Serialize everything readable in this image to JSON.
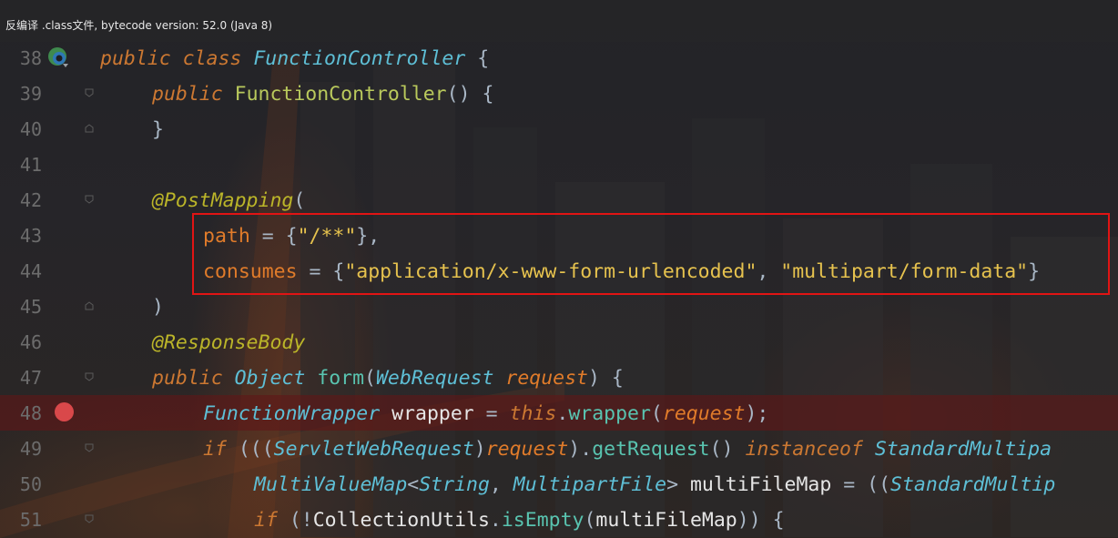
{
  "window": {
    "title": "反编译 .class文件, bytecode version: 52.0 (Java 8)"
  },
  "colors": {
    "keyword": "#cc7832",
    "string": "#e6c24e",
    "annotation": "#bbb529",
    "type": "#5ebfd6",
    "method": "#59c4b0",
    "highlight_border": "#e11414",
    "breakpoint": "#d9484a",
    "breakpoint_line": "#5f1616"
  },
  "gutter": {
    "line_numbers": [
      "38",
      "39",
      "40",
      "41",
      "42",
      "43",
      "44",
      "45",
      "46",
      "47",
      "48",
      "49",
      "50",
      "51"
    ],
    "class_icon": "class-implementation-icon",
    "breakpoint_line": "48"
  },
  "code": {
    "l38": {
      "kw1": "public",
      "kw2": "class",
      "name": "FunctionController",
      "brace": " {"
    },
    "l39": {
      "kw1": "public",
      "name": "FunctionController",
      "rest": "() {"
    },
    "l40": {
      "brace": "}"
    },
    "l42": {
      "ann": "@PostMapping",
      "paren": "("
    },
    "l43": {
      "attr": "path",
      "eq": " = {",
      "str": "\"/**\"",
      "end": "},"
    },
    "l44": {
      "attr": "consumes",
      "eq": " = {",
      "str1": "\"application/x-www-form-urlencoded\"",
      "comma": ", ",
      "str2": "\"multipart/form-data\"",
      "end": "}"
    },
    "l45": {
      "paren": ")"
    },
    "l46": {
      "ann": "@ResponseBody"
    },
    "l47": {
      "kw1": "public",
      "type": "Object",
      "method": "form",
      "open": "(",
      "ptype": "WebRequest",
      "pname": "request",
      "close": ") {"
    },
    "l48": {
      "type": "FunctionWrapper",
      "var": " wrapper",
      "eq": " = ",
      "kw": "this",
      "dot": ".",
      "method": "wrapper",
      "open": "(",
      "arg": "request",
      "close": ");"
    },
    "l49": {
      "kw": "if",
      "p1": " (((",
      "type": "ServletWebRequest",
      "p2": ")",
      "arg": "request",
      "p3": ").",
      "method": "getRequest",
      "p4": "() ",
      "kw2": "instanceof",
      "sp": " ",
      "type2": "StandardMultipa"
    },
    "l50": {
      "type1": "MultiValueMap",
      "lt": "<",
      "type2": "String",
      "comma": ", ",
      "type3": "MultipartFile",
      "gt": ">",
      "var": " multiFileMap",
      "eq": " = ",
      "p": "((",
      "type4": "StandardMultip"
    },
    "l51": {
      "kw": "if",
      "p1": " (!",
      "cls": "CollectionUtils",
      "dot": ".",
      "method": "isEmpty",
      "p2": "(",
      "arg": "multiFileMap",
      "p3": ")) {"
    }
  }
}
